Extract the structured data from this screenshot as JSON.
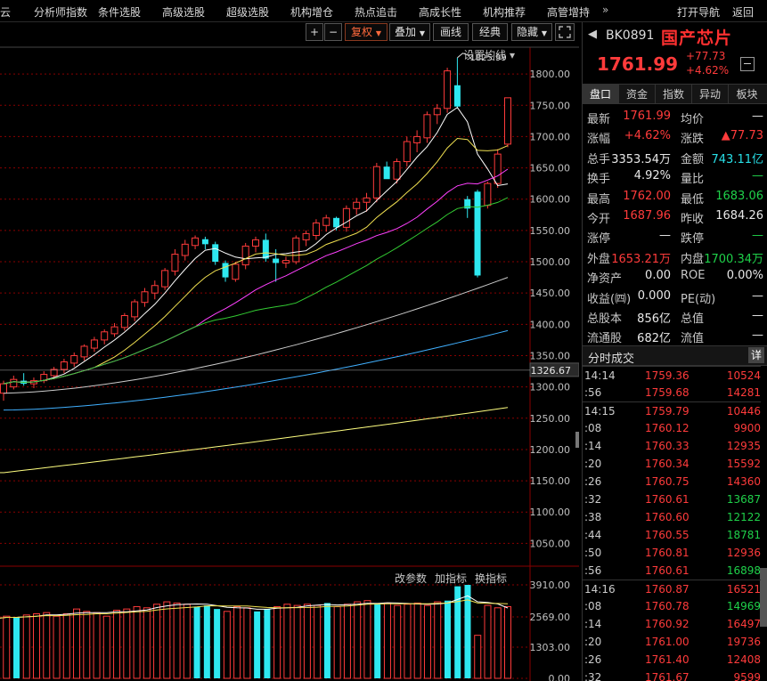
{
  "menu": {
    "items": [
      "云",
      "分析师指数",
      "条件选股",
      "高级选股",
      "超级选股",
      "机构增仓",
      "热点追击",
      "高成长性",
      "机构推荐",
      "高管增持"
    ],
    "more": "»",
    "open_nav": "打开导航",
    "back": "返回"
  },
  "toolbar": {
    "plus": "+",
    "minus": "−",
    "fuquan": "复权",
    "diejia": "叠加",
    "huaxian": "画线",
    "jingdian": "经典",
    "yincang": "隐藏",
    "fullscreen_icon": "expand-icon"
  },
  "chart": {
    "ma_setting": "设置均线",
    "peak_label": "1825.99",
    "current_axis_label": "1326.67",
    "vol_btn_params": "改参数",
    "vol_btn_add": "加指标",
    "vol_btn_switch": "换指标",
    "colors": {
      "up": "#ff3b3b",
      "down": "#2ee8f0",
      "ma5": "#ffffff",
      "ma10": "#f0e050",
      "ma20": "#ff40ff",
      "ma30": "#33cc33",
      "ma60": "#cccccc",
      "ma120": "#40b0ff",
      "ma250": "#ffff80",
      "grid": "#8a0000"
    }
  },
  "chart_data": {
    "type": "candlestick",
    "ylim": [
      1015,
      1840
    ],
    "price_ticks": [
      "1800.00",
      "1750.00",
      "1700.00",
      "1650.00",
      "1600.00",
      "1550.00",
      "1500.00",
      "1450.00",
      "1400.00",
      "1350.00",
      "1300.00",
      "1250.00",
      "1200.00",
      "1150.00",
      "1100.00",
      "1050.00"
    ],
    "volume_ticks": [
      "3910.00",
      "2569.00",
      "1303.00",
      "0.00"
    ],
    "candles": [
      {
        "o": 1290,
        "h": 1310,
        "l": 1278,
        "c": 1305
      },
      {
        "o": 1300,
        "h": 1318,
        "l": 1296,
        "c": 1312
      },
      {
        "o": 1310,
        "h": 1322,
        "l": 1302,
        "c": 1305
      },
      {
        "o": 1305,
        "h": 1315,
        "l": 1298,
        "c": 1310
      },
      {
        "o": 1310,
        "h": 1325,
        "l": 1306,
        "c": 1320
      },
      {
        "o": 1318,
        "h": 1332,
        "l": 1312,
        "c": 1328
      },
      {
        "o": 1328,
        "h": 1345,
        "l": 1322,
        "c": 1340
      },
      {
        "o": 1338,
        "h": 1355,
        "l": 1332,
        "c": 1350
      },
      {
        "o": 1348,
        "h": 1368,
        "l": 1342,
        "c": 1365
      },
      {
        "o": 1362,
        "h": 1380,
        "l": 1356,
        "c": 1375
      },
      {
        "o": 1375,
        "h": 1392,
        "l": 1368,
        "c": 1388
      },
      {
        "o": 1385,
        "h": 1402,
        "l": 1380,
        "c": 1396
      },
      {
        "o": 1395,
        "h": 1418,
        "l": 1390,
        "c": 1414
      },
      {
        "o": 1412,
        "h": 1440,
        "l": 1405,
        "c": 1436
      },
      {
        "o": 1435,
        "h": 1458,
        "l": 1428,
        "c": 1452
      },
      {
        "o": 1450,
        "h": 1470,
        "l": 1440,
        "c": 1462
      },
      {
        "o": 1460,
        "h": 1490,
        "l": 1455,
        "c": 1486
      },
      {
        "o": 1485,
        "h": 1520,
        "l": 1478,
        "c": 1512
      },
      {
        "o": 1510,
        "h": 1535,
        "l": 1502,
        "c": 1528
      },
      {
        "o": 1526,
        "h": 1542,
        "l": 1520,
        "c": 1538
      },
      {
        "o": 1536,
        "h": 1540,
        "l": 1520,
        "c": 1528
      },
      {
        "o": 1528,
        "h": 1532,
        "l": 1495,
        "c": 1500
      },
      {
        "o": 1498,
        "h": 1502,
        "l": 1468,
        "c": 1475
      },
      {
        "o": 1472,
        "h": 1500,
        "l": 1468,
        "c": 1496
      },
      {
        "o": 1495,
        "h": 1530,
        "l": 1488,
        "c": 1525
      },
      {
        "o": 1525,
        "h": 1540,
        "l": 1515,
        "c": 1535
      },
      {
        "o": 1535,
        "h": 1545,
        "l": 1500,
        "c": 1505
      },
      {
        "o": 1505,
        "h": 1520,
        "l": 1468,
        "c": 1498
      },
      {
        "o": 1498,
        "h": 1508,
        "l": 1490,
        "c": 1502
      },
      {
        "o": 1500,
        "h": 1542,
        "l": 1496,
        "c": 1538
      },
      {
        "o": 1535,
        "h": 1550,
        "l": 1525,
        "c": 1545
      },
      {
        "o": 1542,
        "h": 1568,
        "l": 1535,
        "c": 1562
      },
      {
        "o": 1558,
        "h": 1575,
        "l": 1548,
        "c": 1570
      },
      {
        "o": 1570,
        "h": 1572,
        "l": 1550,
        "c": 1555
      },
      {
        "o": 1555,
        "h": 1590,
        "l": 1548,
        "c": 1585
      },
      {
        "o": 1585,
        "h": 1602,
        "l": 1575,
        "c": 1595
      },
      {
        "o": 1595,
        "h": 1610,
        "l": 1580,
        "c": 1602
      },
      {
        "o": 1602,
        "h": 1658,
        "l": 1595,
        "c": 1652
      },
      {
        "o": 1652,
        "h": 1660,
        "l": 1635,
        "c": 1632
      },
      {
        "o": 1632,
        "h": 1665,
        "l": 1625,
        "c": 1660
      },
      {
        "o": 1660,
        "h": 1700,
        "l": 1652,
        "c": 1692
      },
      {
        "o": 1690,
        "h": 1710,
        "l": 1675,
        "c": 1700
      },
      {
        "o": 1698,
        "h": 1740,
        "l": 1690,
        "c": 1735
      },
      {
        "o": 1735,
        "h": 1752,
        "l": 1720,
        "c": 1745
      },
      {
        "o": 1745,
        "h": 1810,
        "l": 1738,
        "c": 1805
      },
      {
        "o": 1782,
        "h": 1826,
        "l": 1745,
        "c": 1748
      },
      {
        "o": 1600,
        "h": 1605,
        "l": 1570,
        "c": 1585
      },
      {
        "o": 1612,
        "h": 1615,
        "l": 1475,
        "c": 1478
      },
      {
        "o": 1590,
        "h": 1628,
        "l": 1585,
        "c": 1625
      },
      {
        "o": 1625,
        "h": 1680,
        "l": 1618,
        "c": 1672
      },
      {
        "o": 1687.96,
        "h": 1762,
        "l": 1683.06,
        "c": 1761.99
      }
    ],
    "volumes": [
      2500,
      2600,
      2550,
      2650,
      2700,
      2750,
      2600,
      2700,
      2900,
      2800,
      2750,
      2600,
      2850,
      2900,
      3000,
      2950,
      3100,
      3200,
      3150,
      3100,
      3000,
      3050,
      2900,
      2800,
      3000,
      2950,
      2800,
      2900,
      3000,
      3100,
      3050,
      3100,
      3050,
      3150,
      3000,
      3100,
      3200,
      3250,
      3100,
      3150,
      3050,
      3100,
      3150,
      3050,
      3200,
      3250,
      3850,
      3910,
      1800,
      3050,
      2950,
      3000
    ]
  },
  "quote": {
    "prev_icon": "chevron-left-icon",
    "next_icon": "chevron-right-icon",
    "code": "BK0891",
    "name": "国产芯片",
    "price": "1761.99",
    "change": "+77.73",
    "change_pct": "+4.62%"
  },
  "tabs": [
    "盘口",
    "资金",
    "指数",
    "异动",
    "板块"
  ],
  "stats": [
    {
      "l": "最新",
      "v": "1761.99",
      "vc": "red",
      "l2": "均价",
      "v2": "—",
      "v2c": "white"
    },
    {
      "l": "涨幅",
      "v": "+4.62%",
      "vc": "red",
      "l2": "涨跌",
      "v2": "▲77.73",
      "v2c": "red"
    },
    {
      "l": "总手",
      "v": "3353.54万",
      "vc": "white",
      "l2": "金额",
      "v2": "743.11亿",
      "v2c": "cyan"
    },
    {
      "l": "换手",
      "v": "4.92%",
      "vc": "white",
      "l2": "量比",
      "v2": "—",
      "v2c": "green"
    },
    {
      "l": "最高",
      "v": "1762.00",
      "vc": "red",
      "l2": "最低",
      "v2": "1683.06",
      "v2c": "green"
    },
    {
      "l": "今开",
      "v": "1687.96",
      "vc": "red",
      "l2": "昨收",
      "v2": "1684.26",
      "v2c": "white"
    },
    {
      "l": "涨停",
      "v": "—",
      "vc": "white",
      "l2": "跌停",
      "v2": "—",
      "v2c": "green"
    },
    {
      "l": "外盘",
      "v": "1653.21万",
      "vc": "red",
      "l2": "内盘",
      "v2": "1700.34万",
      "v2c": "green"
    },
    {
      "l": "净资产",
      "v": "0.00",
      "vc": "white",
      "l2": "ROE",
      "v2": "0.00%",
      "v2c": "white"
    },
    {
      "l": "收益(㈣)",
      "v": "0.000",
      "vc": "white",
      "l2": "PE(动)",
      "v2": "—",
      "v2c": "white"
    },
    {
      "l": "总股本",
      "v": "856亿",
      "vc": "white",
      "l2": "总值",
      "v2": "—",
      "v2c": "white"
    },
    {
      "l": "流通股",
      "v": "682亿",
      "vc": "white",
      "l2": "流值",
      "v2": "—",
      "v2c": "white"
    }
  ],
  "ticks_header": "分时成交",
  "ticks_detail": "详",
  "ticks": [
    {
      "t": "14:14",
      "p": "1759.36",
      "v": "10524",
      "vc": "red",
      "major": true
    },
    {
      "t": ":56",
      "p": "1759.68",
      "v": "14281",
      "vc": "red",
      "major": false
    },
    {
      "t": "14:15",
      "p": "1759.79",
      "v": "10446",
      "vc": "red",
      "major": true
    },
    {
      "t": ":08",
      "p": "1760.12",
      "v": "9900",
      "vc": "red",
      "major": false
    },
    {
      "t": ":14",
      "p": "1760.33",
      "v": "12935",
      "vc": "red",
      "major": false
    },
    {
      "t": ":20",
      "p": "1760.34",
      "v": "15592",
      "vc": "red",
      "major": false
    },
    {
      "t": ":26",
      "p": "1760.75",
      "v": "14360",
      "vc": "red",
      "major": false
    },
    {
      "t": ":32",
      "p": "1760.61",
      "v": "13687",
      "vc": "green",
      "major": false
    },
    {
      "t": ":38",
      "p": "1760.60",
      "v": "12122",
      "vc": "green",
      "major": false
    },
    {
      "t": ":44",
      "p": "1760.55",
      "v": "18781",
      "vc": "green",
      "major": false
    },
    {
      "t": ":50",
      "p": "1760.81",
      "v": "12936",
      "vc": "red",
      "major": false
    },
    {
      "t": ":56",
      "p": "1760.61",
      "v": "16898",
      "vc": "green",
      "major": false
    },
    {
      "t": "14:16",
      "p": "1760.87",
      "v": "16521",
      "vc": "red",
      "major": true
    },
    {
      "t": ":08",
      "p": "1760.78",
      "v": "14969",
      "vc": "green",
      "major": false
    },
    {
      "t": ":14",
      "p": "1760.92",
      "v": "16497",
      "vc": "red",
      "major": false
    },
    {
      "t": ":20",
      "p": "1761.00",
      "v": "19736",
      "vc": "red",
      "major": false
    },
    {
      "t": ":26",
      "p": "1761.40",
      "v": "12408",
      "vc": "red",
      "major": false
    },
    {
      "t": ":32",
      "p": "1761.67",
      "v": "9599",
      "vc": "red",
      "major": false
    }
  ]
}
